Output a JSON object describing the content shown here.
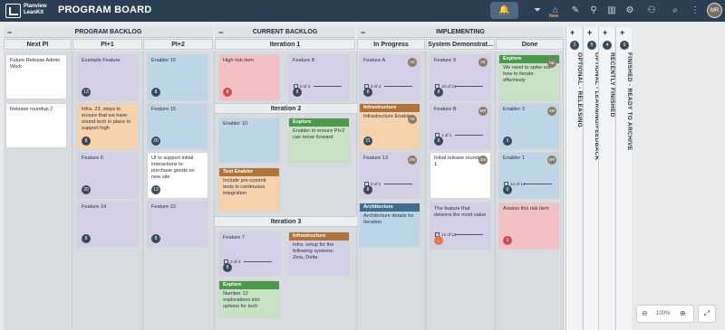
{
  "app": {
    "brand": "Planview LeanKit",
    "board_title": "PROGRAM BOARD",
    "new_label": "New",
    "user_initials": "MR"
  },
  "sections": {
    "program_backlog": "PROGRAM BACKLOG",
    "current_backlog": "CURRENT BACKLOG",
    "implementing": "IMPLEMENTING"
  },
  "columns": {
    "next_pi": "Next PI",
    "pi1": "PI+1",
    "pi2": "PI+2",
    "iteration1": "Iteration 1",
    "iteration2": "Iteration 2",
    "iteration3": "Iteration 3",
    "in_progress": "In Progress",
    "system_demo": "System Demonstrat...",
    "done": "Done"
  },
  "vertical_columns": [
    {
      "count": "2",
      "label": "OPTIONAL - RELEASING"
    },
    {
      "count": "5",
      "label": "OPTIONAL - LEARNING/FEEDBACK"
    },
    {
      "count": "4",
      "label": "RECENTLY FINISHED"
    },
    {
      "count": "0",
      "label": "FINISHED - READY TO ARCHIVE"
    }
  ],
  "cards": {
    "np1": {
      "text": "Future Release Admin Work"
    },
    "np2": {
      "text": "Release roundup 2"
    },
    "p1a": {
      "text": "Example Feature",
      "badge": "13"
    },
    "p1b": {
      "text": "Infra. 23, steps to ensure that we have sound tech in place to support high",
      "badge": "8"
    },
    "p1c": {
      "text": "Feature 6",
      "badge": "20"
    },
    "p1d": {
      "text": "Feature 14",
      "badge": "8"
    },
    "p2a": {
      "text": "Enabler 15",
      "badge": "8"
    },
    "p2b": {
      "text": "Feature 15",
      "badge": "20"
    },
    "p2c": {
      "text": "UI to support initial interactions to purchase goods on new site",
      "badge": "13"
    },
    "p2d": {
      "text": "Feature 22",
      "badge": "8"
    },
    "i1a": {
      "text": "High risk item",
      "badge": "8"
    },
    "i1b": {
      "text": "Feature 8",
      "progress": "0 of 3",
      "badge": "8"
    },
    "i2a": {
      "text": "Enabler 10",
      "badge": ""
    },
    "i2b": {
      "tag": "Explore",
      "text": "Enabler to ensure PI+2 can move forward"
    },
    "i2c": {
      "tag": "Test Enabler",
      "text": "Include pre-commit tests in continuous integration"
    },
    "i3a": {
      "text": "Feature 7",
      "progress": "0 of 4",
      "badge": "8"
    },
    "i3b": {
      "tag": "Infrastructure",
      "text": "Infra. setup for the following systems: Zeta, Delta"
    },
    "i3c": {
      "tag": "Explore",
      "text": "Number 12 explorations into options for tech"
    },
    "ipa": {
      "text": "Feature A",
      "progress": "0 of 4",
      "badge": "8",
      "avatar": "AE"
    },
    "ipb": {
      "tag": "Infrastructure",
      "text": "Infrastructure Enabler",
      "badge": "21",
      "avatar": "AE"
    },
    "ipc": {
      "text": "Feature 13",
      "progress": "0 of 2",
      "badge": "8",
      "avatar": "ZM"
    },
    "ipd": {
      "tag": "Architecture",
      "text": "Architecture details for Iteration"
    },
    "sda": {
      "text": "Feature 9",
      "progress": "10 of 10",
      "badge": "8",
      "avatar": "AE"
    },
    "sdb": {
      "text": "Feature B",
      "progress": "1 of 1",
      "badge": "8",
      "avatar": "MR"
    },
    "sdc": {
      "text": "Initial release roundup 1",
      "badge": "",
      "avatar": "ZM"
    },
    "sdd": {
      "text": "The feature that delivers the most value",
      "progress": "12 of 12",
      "badge": "8"
    },
    "dna": {
      "tag": "Explore",
      "text": "We need to spike out how to iterate effectively",
      "avatar": "AE"
    },
    "dnb": {
      "text": "Enabler 3",
      "badge": "5",
      "avatar": "ZM"
    },
    "dnc": {
      "text": "Enabler 1",
      "progress": "14 of 14",
      "badge": "8",
      "avatar": "MR"
    },
    "dnd": {
      "text": "Assess this risk item",
      "badge": "1"
    }
  },
  "zoom": {
    "level": "100%"
  },
  "colors": {
    "topbar": "#2b3f52",
    "explore": "#4b9a4b",
    "infrastructure": "#b0743a",
    "test_enabler": "#b0743a",
    "architecture": "#3f6f8e"
  },
  "icons": [
    "bell-icon",
    "filter-icon",
    "tag-icon",
    "search-icon",
    "bar-chart-icon",
    "gear-icon",
    "add-user-icon",
    "zoom-out-icon",
    "zoom-in-icon",
    "fit-screen-icon"
  ]
}
